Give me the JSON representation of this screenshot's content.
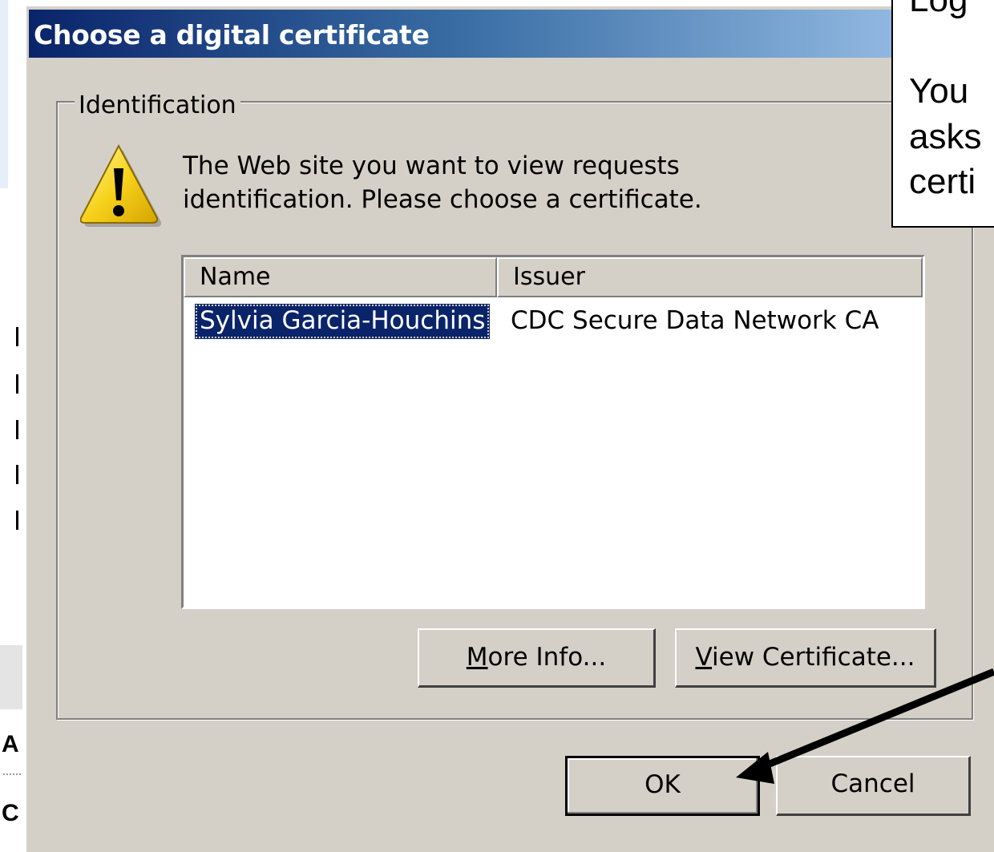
{
  "dialog": {
    "title": "Choose a digital certificate",
    "group_label": "Identification",
    "message_line1": "The Web site you want to view requests",
    "message_line2": "identification. Please choose a certificate.",
    "warning_icon": "warning-triangle-icon"
  },
  "certificates": {
    "columns": [
      "Name",
      "Issuer"
    ],
    "rows": [
      {
        "name": "Sylvia Garcia-Houchins",
        "issuer": "CDC Secure Data Network CA",
        "selected": true
      }
    ]
  },
  "buttons": {
    "more_info": {
      "mnemonic": "M",
      "rest": "ore Info..."
    },
    "view_certificate": {
      "mnemonic": "V",
      "rest": "iew Certificate..."
    },
    "ok": "OK",
    "cancel": "Cancel"
  },
  "callout": {
    "line1": "Log",
    "line2": "You",
    "line3": "asks",
    "line4": "certi"
  },
  "background": {
    "letter_a": "A",
    "letter_c": "C"
  },
  "colors": {
    "titlebar_start": "#0a246a",
    "titlebar_end": "#a6caf0",
    "dialog_face": "#d4d0c8",
    "selection": "#0a246a"
  }
}
